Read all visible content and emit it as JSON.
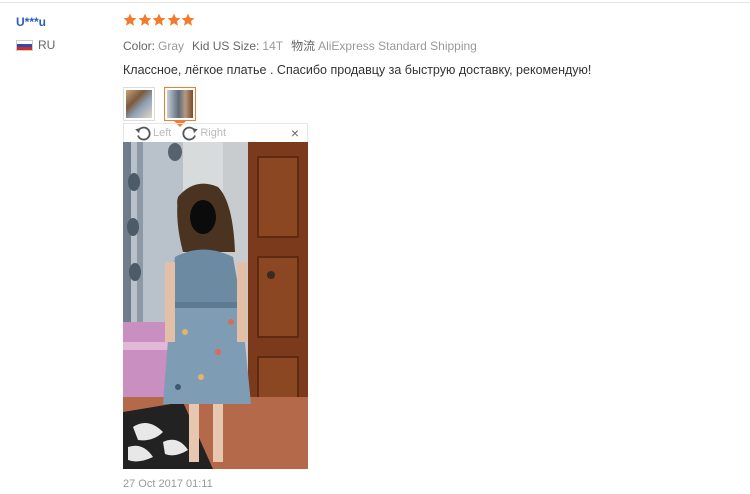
{
  "user": {
    "name": "U***u",
    "country_code": "RU"
  },
  "rating": {
    "stars": 5,
    "max": 5,
    "color": "#f07c2d"
  },
  "attributes": [
    {
      "label": "Color:",
      "value": "Gray"
    },
    {
      "label": "Kid US Size:",
      "value": "14T"
    },
    {
      "label": "物流",
      "value": "AliExpress Standard Shipping"
    }
  ],
  "feedback_text": "Классное, лёгкое платье . Спасибо продавцу за быструю доставку, рекомендую!",
  "viewer": {
    "rotate_left_label": "Left",
    "rotate_right_label": "Right",
    "close_symbol": "×"
  },
  "date": "27 Oct 2017 01:11",
  "colors": {
    "accent": "#f07c2d",
    "username": "#2b5fb4"
  }
}
